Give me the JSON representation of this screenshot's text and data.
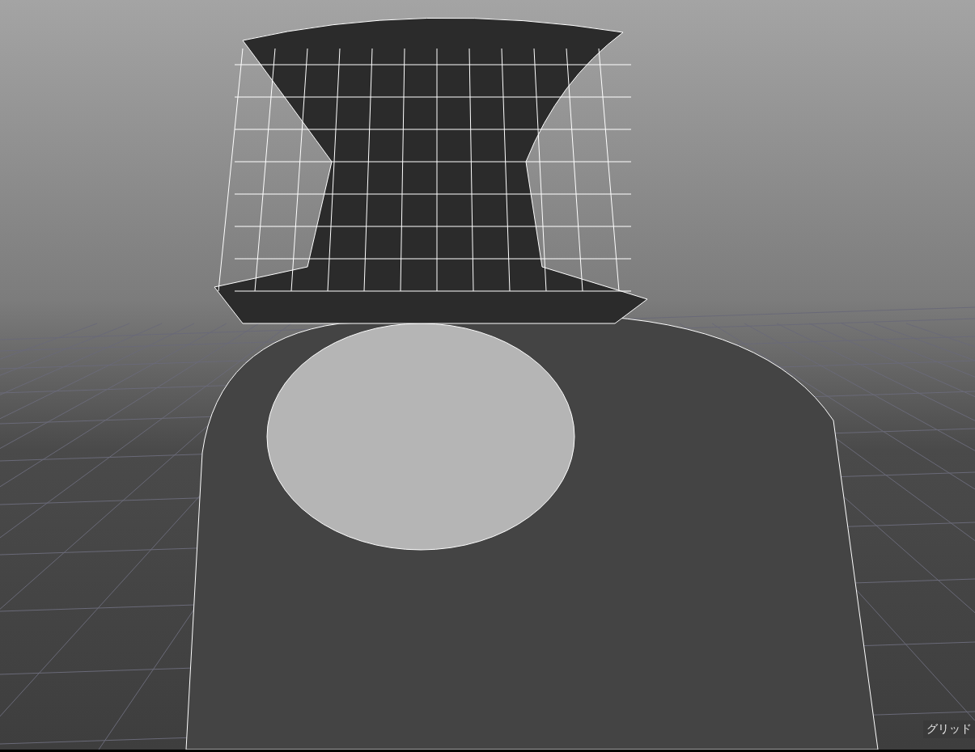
{
  "viewport": {
    "overlay_label": "グリッド"
  }
}
